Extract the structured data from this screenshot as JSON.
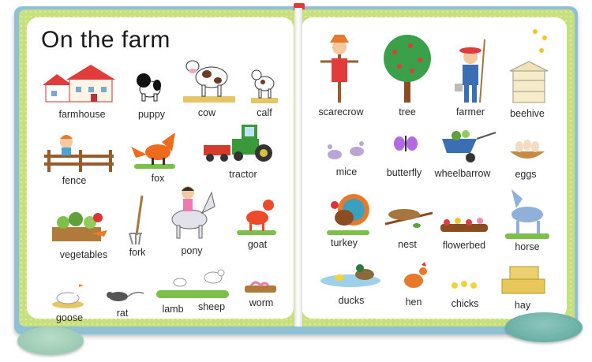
{
  "page": {
    "title": "On the farm"
  },
  "labels": {
    "farmhouse": "farmhouse",
    "puppy": "puppy",
    "cow": "cow",
    "calf": "calf",
    "fence": "fence",
    "fox": "fox",
    "tractor": "tractor",
    "vegetables": "vegetables",
    "fork": "fork",
    "pony": "pony",
    "goat": "goat",
    "goose": "goose",
    "rat": "rat",
    "lamb": "lamb",
    "sheep": "sheep",
    "worm": "worm",
    "scarecrow": "scarecrow",
    "tree": "tree",
    "farmer": "farmer",
    "beehive": "beehive",
    "mice": "mice",
    "butterfly": "butterfly",
    "wheelbarrow": "wheelbarrow",
    "eggs": "eggs",
    "turkey": "turkey",
    "nest": "nest",
    "flowerbed": "flowerbed",
    "horse": "horse",
    "ducks": "ducks",
    "hen": "hen",
    "chicks": "chicks",
    "hay": "hay"
  },
  "colors": {
    "book_cover": "#8ec0d6",
    "page_border": "#c8df7d",
    "page_bg": "#ffffff",
    "grass": "#7cc04a"
  }
}
